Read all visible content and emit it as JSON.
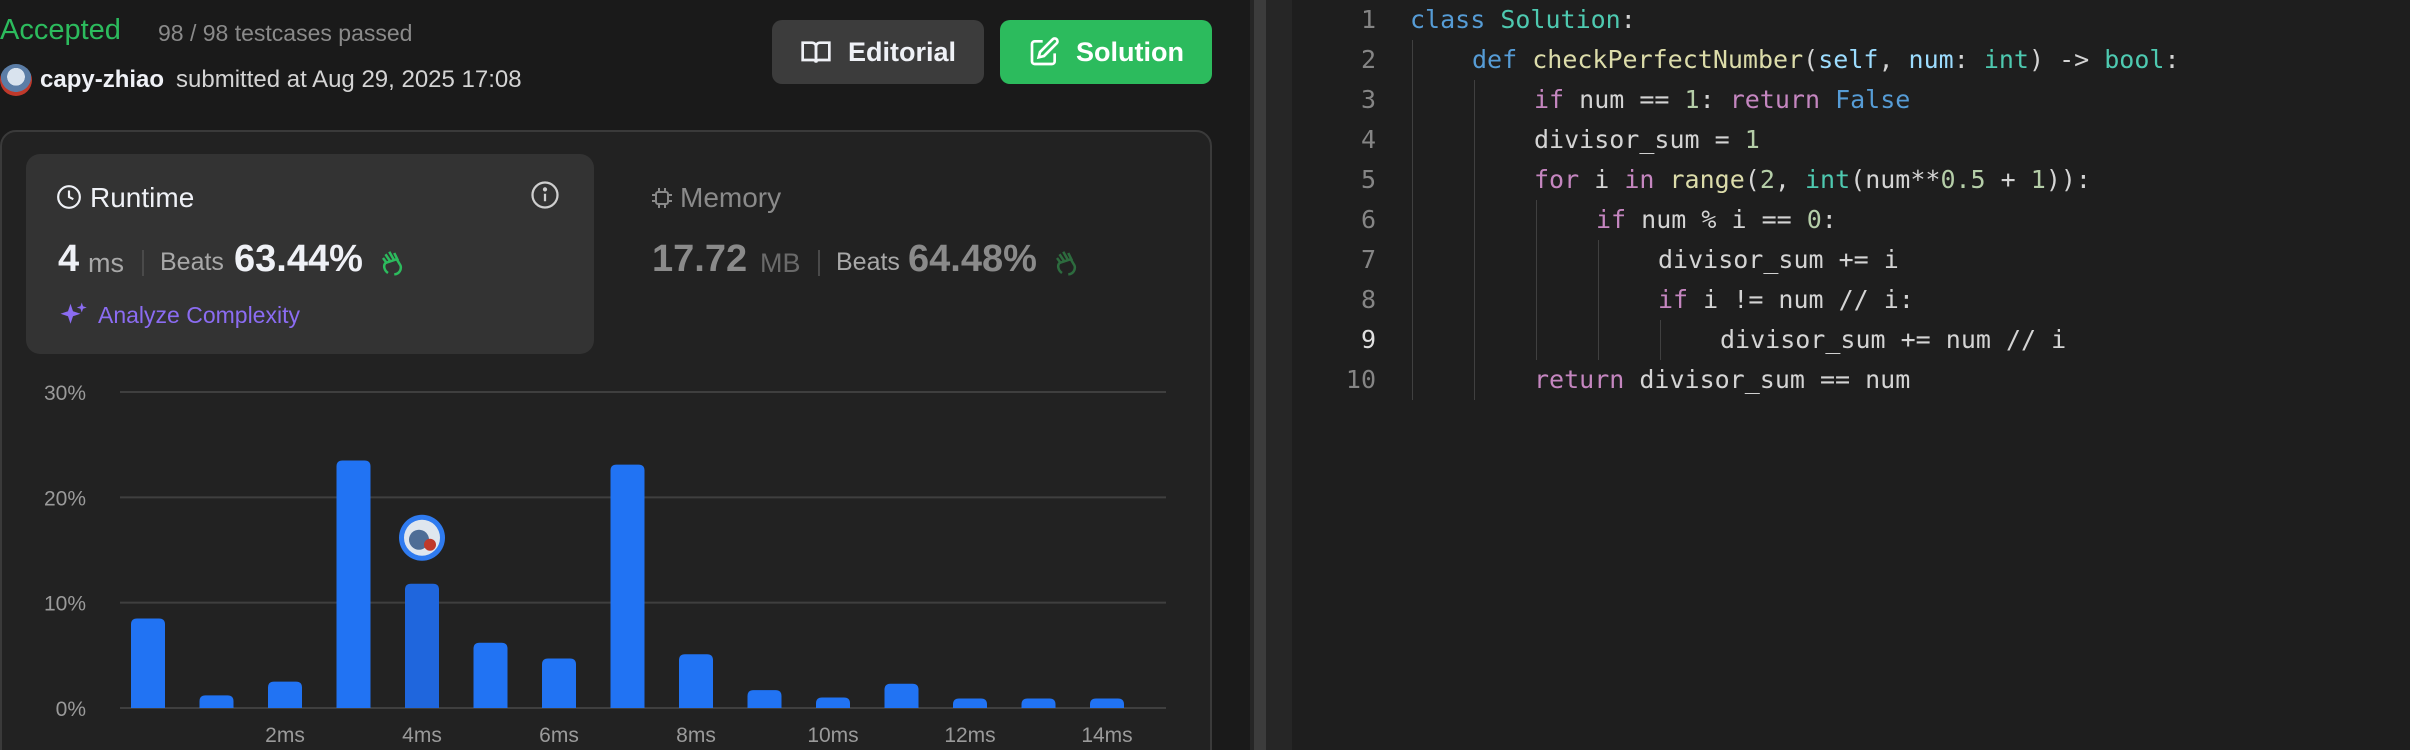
{
  "submission": {
    "status": "Accepted",
    "testcases": "98 / 98 testcases passed",
    "user": "capy-zhiao",
    "submitted_text": "submitted at Aug 29, 2025 17:08"
  },
  "buttons": {
    "editorial": "Editorial",
    "solution": "Solution"
  },
  "runtime": {
    "title": "Runtime",
    "value": "4",
    "unit": "ms",
    "beats_label": "Beats",
    "beats_pct": "63.44%",
    "analyze": "Analyze Complexity"
  },
  "memory": {
    "title": "Memory",
    "value": "17.72",
    "unit": "MB",
    "beats_label": "Beats",
    "beats_pct": "64.48%"
  },
  "colors": {
    "accepted": "#2cbb5d",
    "bar": "#2173f3",
    "accent_purple": "#8b6cf2"
  },
  "chart_data": {
    "type": "bar",
    "yticks": [
      "30%",
      "20%",
      "10%",
      "0%"
    ],
    "ylim": [
      0,
      30
    ],
    "xtick_labels": [
      "2ms",
      "4ms",
      "6ms",
      "8ms",
      "10ms",
      "12ms",
      "14ms"
    ],
    "values": [
      8.5,
      1.2,
      2.5,
      23.5,
      11.8,
      6.2,
      4.7,
      23.1,
      5.1,
      1.7,
      1.0,
      2.3,
      0.9,
      0.9,
      0.9
    ],
    "highlight_index": 4
  },
  "code": {
    "lines": [
      {
        "n": "1"
      },
      {
        "n": "2"
      },
      {
        "n": "3"
      },
      {
        "n": "4"
      },
      {
        "n": "5"
      },
      {
        "n": "6"
      },
      {
        "n": "7"
      },
      {
        "n": "8"
      },
      {
        "n": "9"
      },
      {
        "n": "10"
      }
    ],
    "active_line": "9",
    "t": {
      "class": "class",
      "Solution": "Solution",
      "colon": ":",
      "def": "def",
      "fname": "checkPerfectNumber",
      "p1": "(",
      "self": "self",
      "comma": ", ",
      "num": "num",
      "colon_sp": ": ",
      "int": "int",
      "arrow": ") -> ",
      "bool": "bool",
      "if": "if",
      "cond1": " num == ",
      "one": "1",
      "colon_sp2": ": ",
      "return": "return",
      "False": " False",
      "ds_assign": "divisor_sum = ",
      "for": "for",
      "i_sp": " i ",
      "in": "in",
      "range": "range",
      "open": "(",
      "two": "2",
      "comma2": ", ",
      "int2": "int",
      "numpow": "(num**",
      "half": "0.5",
      "plus": " + ",
      "one2": "1",
      "close": ")):",
      "cond2": " num % i == ",
      "zero": "0",
      "colon2": ":",
      "ds_add": "divisor_sum += i",
      "cond3": " i != num // i:",
      "ds_add2": "divisor_sum += num // i",
      "ret_expr": " divisor_sum == num"
    }
  }
}
